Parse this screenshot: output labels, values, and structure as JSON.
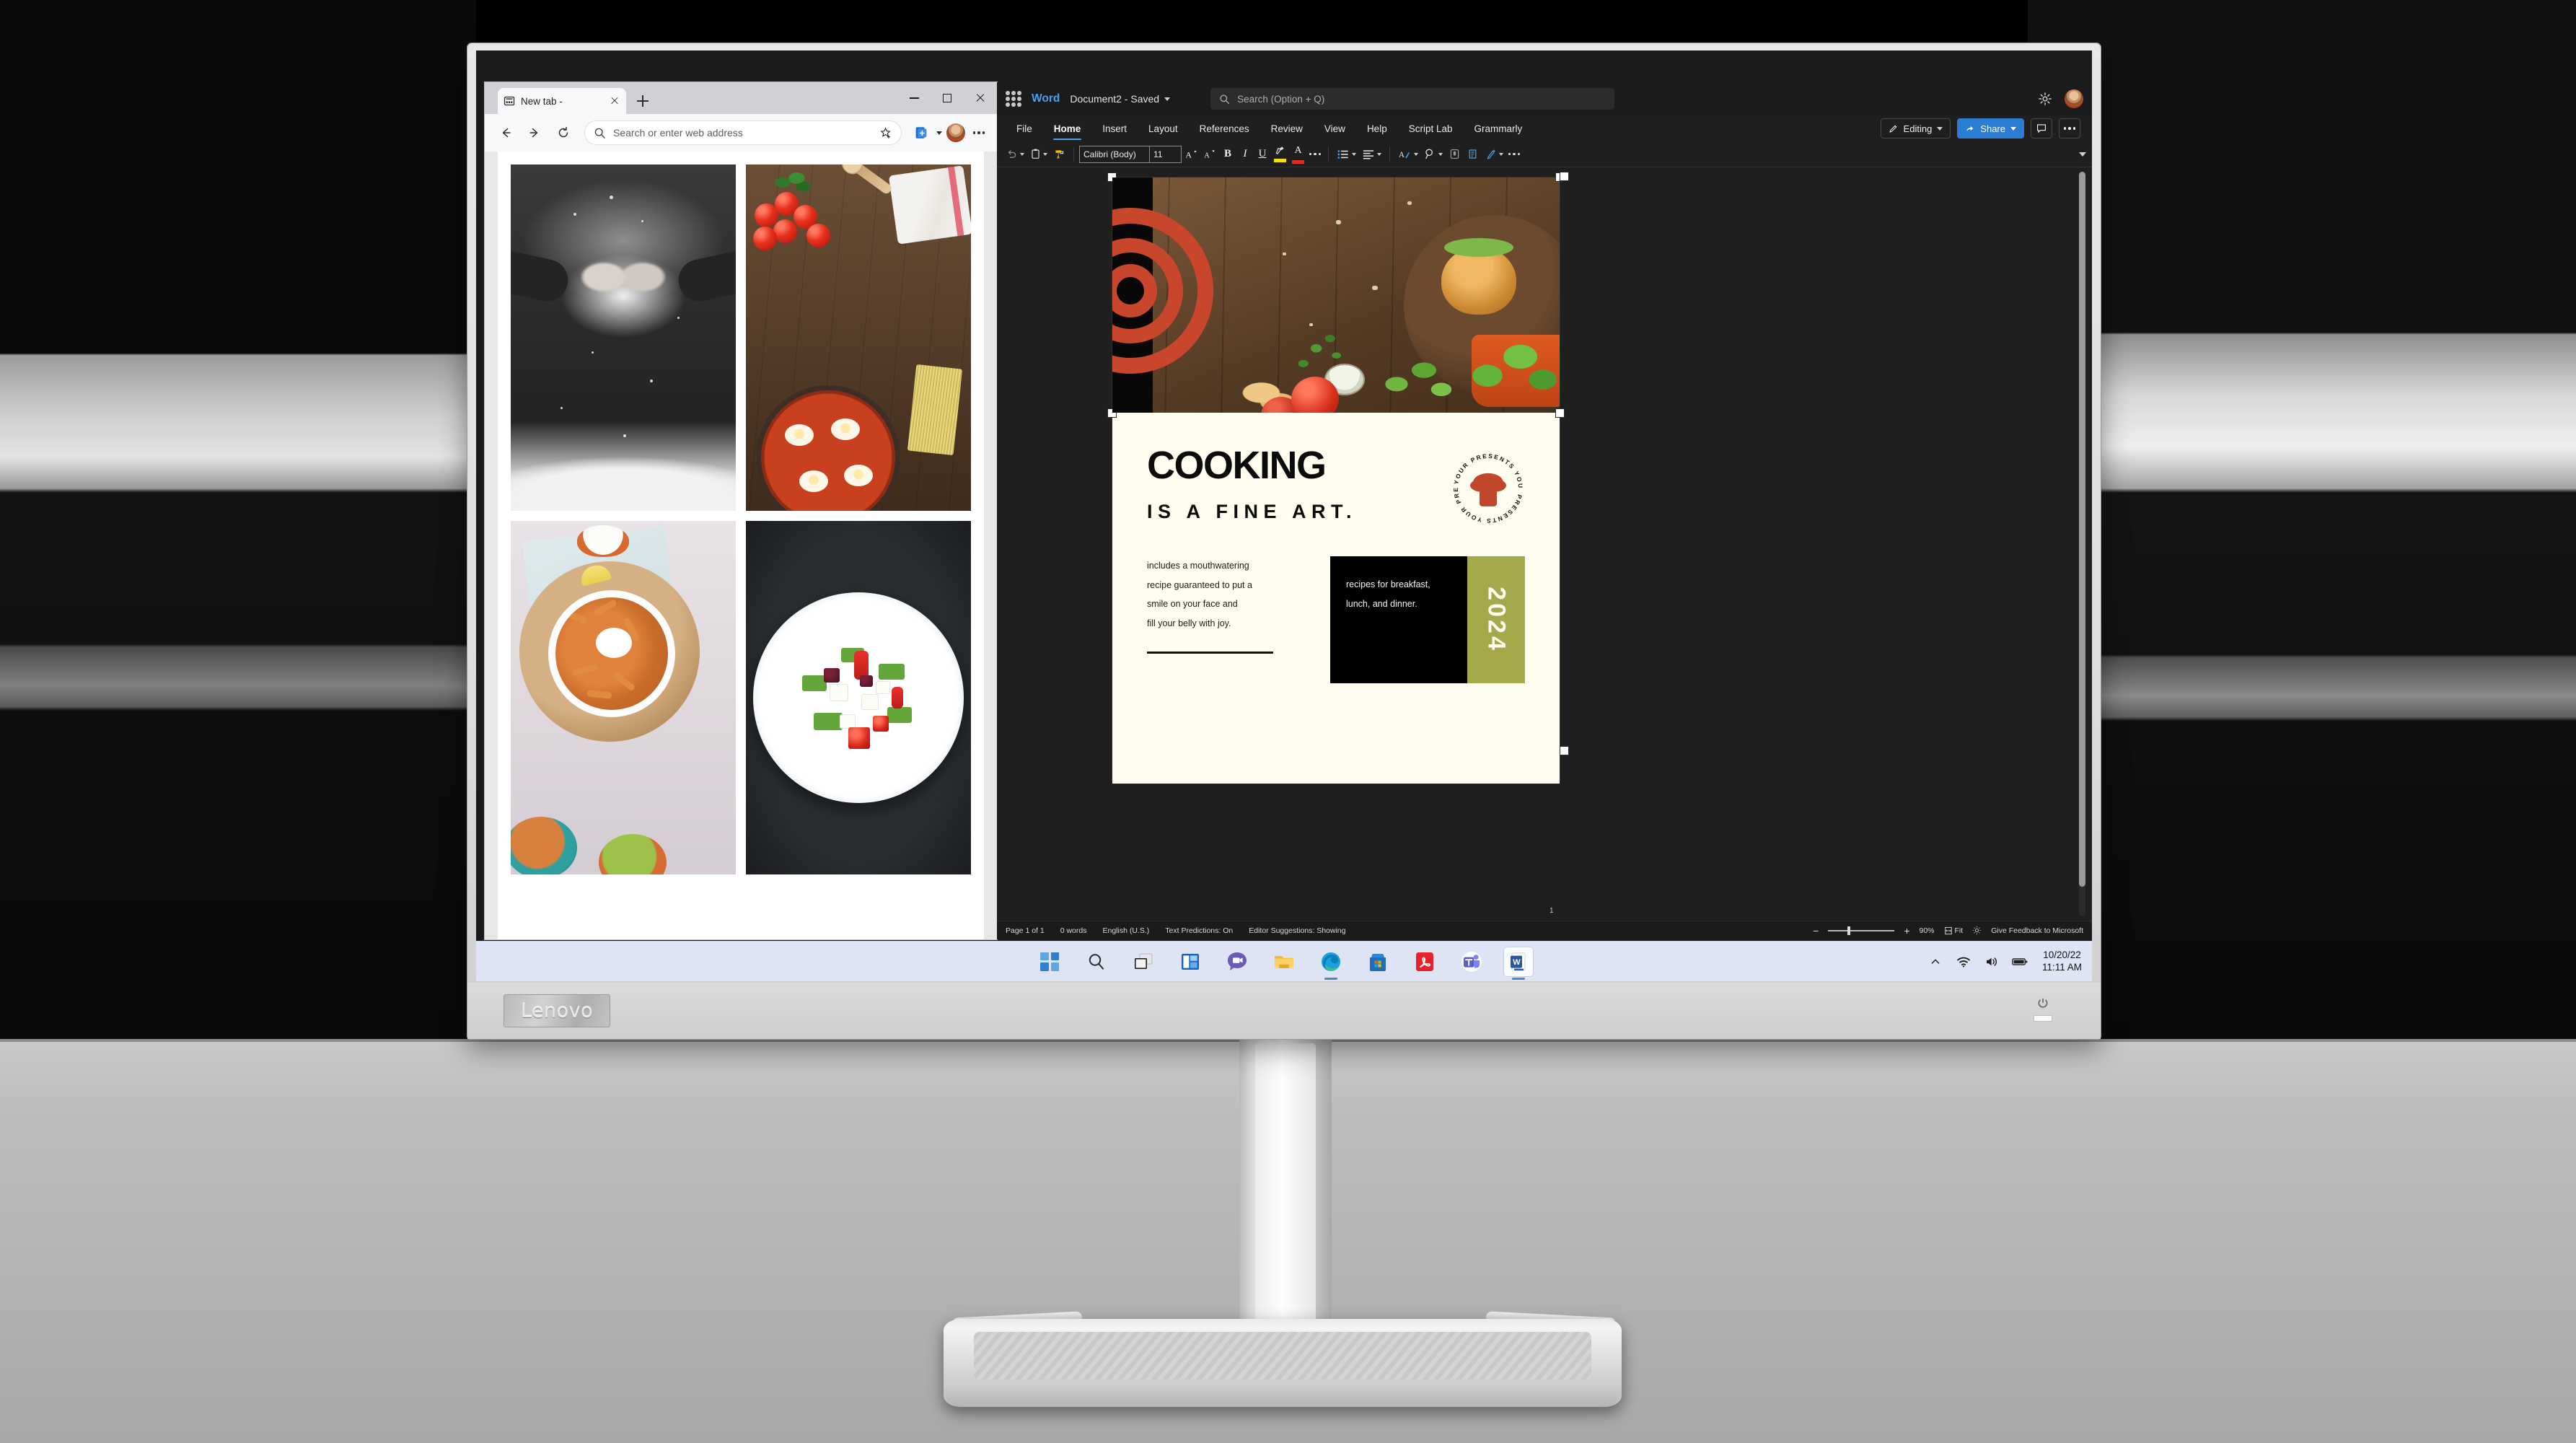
{
  "monitor": {
    "brand": "Lenovo"
  },
  "browser": {
    "tab": {
      "title": "New tab -",
      "favicon_icon": "page-icon",
      "close_icon": "close-icon"
    },
    "new_tab_icon": "plus-icon",
    "window_controls": {
      "minimize": "minimize-icon",
      "maximize": "maximize-icon",
      "close": "close-icon"
    },
    "nav": {
      "back_icon": "arrow-left-icon",
      "forward_icon": "arrow-right-icon",
      "reload_icon": "refresh-icon"
    },
    "omnibox": {
      "placeholder": "Search or enter web address",
      "value": "",
      "search_icon": "search-icon",
      "favorite_icon": "star-plus-icon"
    },
    "collections_icon": "collections-icon",
    "profile_icon": "avatar",
    "more_icon": "ellipsis-icon",
    "page": {
      "images": [
        {
          "name": "hands-kneading-flour-bw",
          "alt": "Black and white hands clapping flour"
        },
        {
          "name": "tomatoes-eggs-skillet",
          "alt": "Cherry tomatoes, wooden spoon, spaghetti and shakshuka pan on wood"
        },
        {
          "name": "sweet-potato-fries-bowl",
          "alt": "Loaded sweet potato fries with dips"
        },
        {
          "name": "greek-salad-white-plate",
          "alt": "Greek salad with feta on a white plate"
        }
      ]
    }
  },
  "word": {
    "waffle_icon": "app-launcher-icon",
    "app_name": "Word",
    "document_title": "Document2 - Saved",
    "document_chevron_icon": "chevron-down-icon",
    "search": {
      "placeholder": "Search (Option + Q)",
      "value": "",
      "icon": "search-icon"
    },
    "settings_icon": "gear-icon",
    "account_icon": "avatar",
    "ribbon_tabs": [
      {
        "label": "File",
        "active": false
      },
      {
        "label": "Home",
        "active": true
      },
      {
        "label": "Insert",
        "active": false
      },
      {
        "label": "Layout",
        "active": false
      },
      {
        "label": "References",
        "active": false
      },
      {
        "label": "Review",
        "active": false
      },
      {
        "label": "View",
        "active": false
      },
      {
        "label": "Help",
        "active": false
      },
      {
        "label": "Script Lab",
        "active": false
      },
      {
        "label": "Grammarly",
        "active": false
      }
    ],
    "ribbon_actions": {
      "editing_label": "Editing",
      "editing_icon": "pencil-icon",
      "share_label": "Share",
      "share_icon": "share-icon",
      "comments_icon": "comment-icon",
      "more_icon": "ellipsis-icon"
    },
    "toolbar": {
      "undo_icon": "undo-icon",
      "paste_icon": "clipboard-icon",
      "format_painter_icon": "format-painter-icon",
      "font_name": "Calibri (Body)",
      "font_size": "11",
      "grow_font_icon": "grow-font-icon",
      "shrink_font_icon": "shrink-font-icon",
      "bold_label": "B",
      "italic_label": "I",
      "underline_label": "U",
      "highlight_icon": "text-highlight-icon",
      "highlight_color": "#f5e003",
      "font_color_icon": "font-color-icon",
      "font_color": "#e02b20",
      "more_font_icon": "ellipsis-icon",
      "bullets_icon": "bullet-list-icon",
      "align_icon": "align-left-icon",
      "styles_icon": "styles-icon",
      "find_icon": "find-icon",
      "dictate_icon": "dictate-icon",
      "editor_icon": "editor-icon",
      "designer_icon": "designer-icon",
      "overflow_icon": "ellipsis-icon",
      "expand_icon": "chevron-down-icon"
    },
    "status_bar": {
      "page": "Page 1 of 1",
      "words": "0 words",
      "language": "English (U.S.)",
      "text_predictions": "Text Predictions: On",
      "editor_suggestions": "Editor Suggestions: Showing",
      "zoom_out_icon": "minus-icon",
      "zoom_in_icon": "plus-icon",
      "zoom_level": "90%",
      "fit_label": "Fit",
      "fit_icon": "fit-width-icon",
      "focus_icon": "focus-mode-icon",
      "feedback": "Give Feedback to Microsoft"
    },
    "page_number_marker": "1",
    "document": {
      "banner_image_name": "rustic-wood-burger-banner",
      "rings_color": "#c8472c",
      "background_color": "#fffdf0",
      "heading": "COOKING",
      "subheading": "IS A FINE ART.",
      "badge_text": "YOUR PRESENTS YOUR PRESENTS YOUR PRESENTS",
      "badge_icon": "chef-hat-icon",
      "paragraph_lines": [
        "includes a mouthwatering",
        "recipe guaranteed to put a",
        "smile on your face and",
        "fill your belly with joy."
      ],
      "black_block_lines": [
        "recipes for breakfast,",
        "lunch, and dinner."
      ],
      "year": "2024",
      "olive_color": "#a5a84b"
    }
  },
  "taskbar": {
    "items": [
      {
        "name": "start-button",
        "icon": "windows-start-icon",
        "label": "Start"
      },
      {
        "name": "search-button",
        "icon": "search-icon",
        "label": "Search"
      },
      {
        "name": "task-view-button",
        "icon": "task-view-icon",
        "label": "Task View"
      },
      {
        "name": "widgets-button",
        "icon": "widgets-icon",
        "label": "Widgets"
      },
      {
        "name": "chat-button",
        "icon": "chat-video-icon",
        "label": "Chat"
      },
      {
        "name": "file-explorer-button",
        "icon": "folder-icon",
        "label": "File Explorer"
      },
      {
        "name": "edge-button",
        "icon": "edge-icon",
        "label": "Microsoft Edge"
      },
      {
        "name": "store-button",
        "icon": "microsoft-store-icon",
        "label": "Microsoft Store"
      },
      {
        "name": "acrobat-button",
        "icon": "adobe-acrobat-icon",
        "label": "Adobe Acrobat"
      },
      {
        "name": "teams-button",
        "icon": "microsoft-teams-icon",
        "label": "Microsoft Teams"
      },
      {
        "name": "word-button",
        "icon": "microsoft-word-icon",
        "label": "Microsoft Word"
      }
    ],
    "tray": {
      "overflow_icon": "chevron-up-icon",
      "wifi_icon": "wifi-icon",
      "volume_icon": "speaker-icon",
      "battery_icon": "battery-icon",
      "date": "10/20/22",
      "time": "11:11 AM"
    }
  }
}
